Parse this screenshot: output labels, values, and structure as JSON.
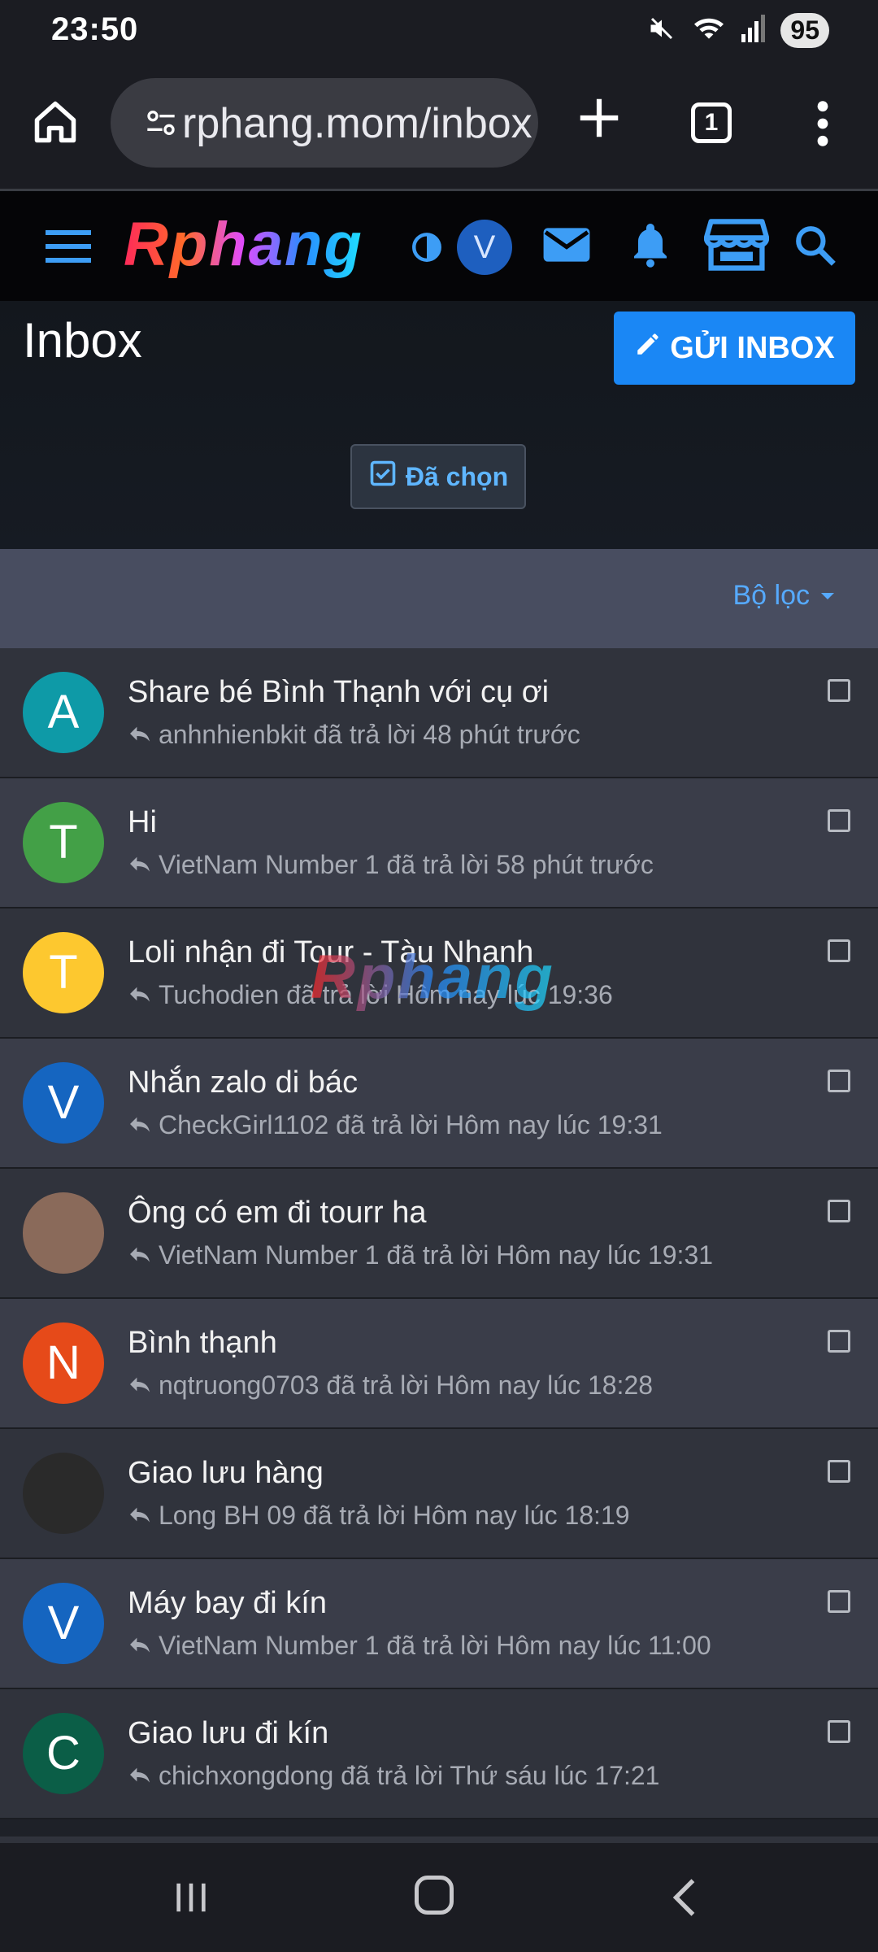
{
  "status_bar": {
    "time": "23:50",
    "battery": "95"
  },
  "browser": {
    "url": "rphang.mom/inbox",
    "tab_count": "1"
  },
  "site": {
    "logo_text": "Rphang",
    "user_initial": "V"
  },
  "page": {
    "title": "Inbox",
    "send_button": "GỬI INBOX",
    "selected_button": "Đã chọn",
    "filter_label": "Bộ lọc"
  },
  "watermark": "Rphang",
  "conversations": [
    {
      "initial": "A",
      "avatar_color": "#0e9aa7",
      "title": "Share bé Bình Thạnh với cụ ơi",
      "subtitle": "anhnhienbkit đã trả lời 48 phút trước"
    },
    {
      "initial": "T",
      "avatar_color": "#43a047",
      "title": "Hi",
      "subtitle": "VietNam Number 1 đã trả lời 58 phút trước"
    },
    {
      "initial": "T",
      "avatar_color": "#fdc82f",
      "title": "Loli nhận đi Tour - Tàu Nhanh",
      "subtitle": "Tuchodien đã trả lời Hôm nay lúc 19:36"
    },
    {
      "initial": "V",
      "avatar_color": "#1565c0",
      "title": "Nhắn zalo di bác",
      "subtitle": "CheckGirl1102 đã trả lời Hôm nay lúc 19:31"
    },
    {
      "initial": "",
      "avatar_color": "#8a6a5a",
      "title": "Ông có em đi tourr ha",
      "subtitle": "VietNam Number 1 đã trả lời Hôm nay lúc 19:31"
    },
    {
      "initial": "N",
      "avatar_color": "#e64a19",
      "title": "Bình thạnh",
      "subtitle": "nqtruong0703 đã trả lời Hôm nay lúc 18:28"
    },
    {
      "initial": "",
      "avatar_color": "#2a2a2a",
      "title": "Giao lưu hàng",
      "subtitle": "Long BH 09 đã trả lời Hôm nay lúc 18:19"
    },
    {
      "initial": "V",
      "avatar_color": "#1565c0",
      "title": "Máy bay đi kín",
      "subtitle": "VietNam Number 1 đã trả lời Hôm nay lúc 11:00"
    },
    {
      "initial": "C",
      "avatar_color": "#0b5e47",
      "title": "Giao lưu đi kín",
      "subtitle": "chichxongdong đã trả lời Thứ sáu lúc 17:21"
    }
  ]
}
